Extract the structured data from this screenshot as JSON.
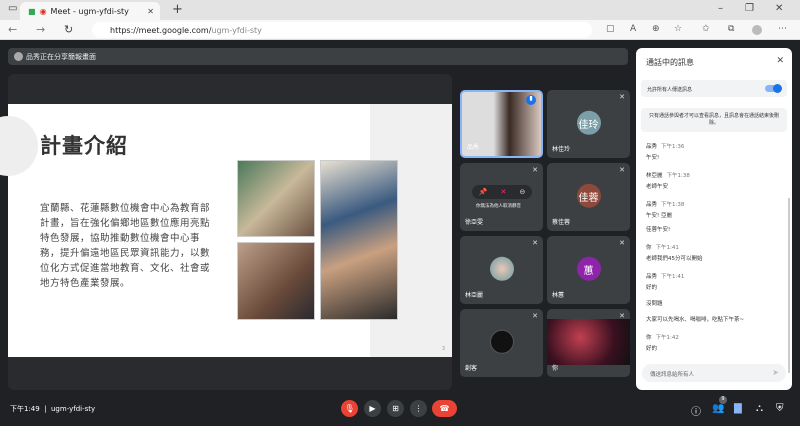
{
  "browser": {
    "tab_title": "Meet - ugm-yfdi-sty",
    "url_host": "https://meet.google.com/",
    "url_path": "ugm-yfdi-sty"
  },
  "banner": {
    "text": "品秀正在分享簡報畫面"
  },
  "slide": {
    "title": "計畫介紹",
    "body": "宜蘭縣、花蓮縣數位機會中心為教育部計畫，旨在強化偏鄉地區數位應用亮點特色發展，協助推動數位機會中心事務，提升偏遠地區民眾資訊能力，以數位化方式促進當地教育、文化、社會或地方特色產業發展。",
    "page": "3"
  },
  "tiles": [
    {
      "name": "品秀",
      "type": "video"
    },
    {
      "name": "林佳玲",
      "avatar": "佳玲",
      "color": "#7b9ea8"
    },
    {
      "name": "徐亞雯",
      "overlay": "你無法為他人取消靜音"
    },
    {
      "name": "蔡佳蓉",
      "avatar": "佳蓉",
      "color": "#8d4a3c"
    },
    {
      "name": "林亞麗",
      "avatar": "",
      "color": "#9ab"
    },
    {
      "name": "林蕙",
      "avatar": "蕙",
      "color": "#8e24aa"
    },
    {
      "name": "創客",
      "avatar": "",
      "color": "#111"
    },
    {
      "name": "你",
      "type": "video"
    }
  ],
  "chat": {
    "title": "通話中的訊息",
    "allow_label": "允許所有人傳送訊息",
    "allow_on": true,
    "note": "只有通話參與者才可以查看訊息，且訊息會在通話結束後刪除。",
    "messages": [
      {
        "sender": "品秀",
        "time": "下午1:36",
        "lines": [
          "午安!"
        ]
      },
      {
        "sender": "林亞麗",
        "time": "下午1:38",
        "lines": [
          "老師午安"
        ]
      },
      {
        "sender": "品秀",
        "time": "下午1:38",
        "lines": [
          "午安! 亞麗",
          "佳蓉午安!"
        ]
      },
      {
        "sender": "你",
        "time": "下午1:41",
        "lines": [
          "老師我們45分可以開始"
        ]
      },
      {
        "sender": "品秀",
        "time": "下午1:41",
        "lines": [
          "好的",
          "沒問題",
          "大家可以先喝水、喝咖啡，吃點下午茶~"
        ]
      },
      {
        "sender": "你",
        "time": "下午1:42",
        "lines": [
          "好的"
        ]
      }
    ],
    "input_placeholder": "傳送訊息給所有人"
  },
  "bottom": {
    "time": "下午1:49",
    "meeting_code": "ugm-yfdi-sty",
    "participants_badge": "9"
  },
  "colors": {
    "end_call": "#ea4335",
    "accent": "#1a73e8",
    "chat_active": "#8ab4f8"
  }
}
